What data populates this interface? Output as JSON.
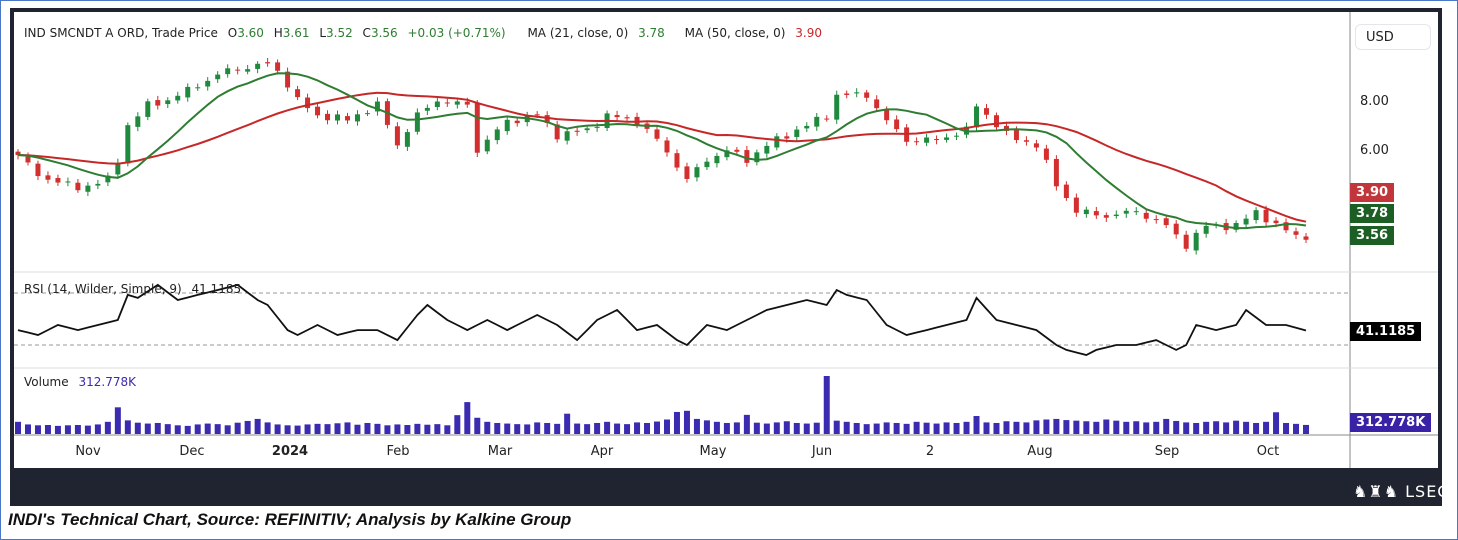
{
  "header": {
    "symbol": "IND SMCNDT A ORD, Trade Price",
    "open_label": "O",
    "open": "3.60",
    "high_label": "H",
    "high": "3.61",
    "low_label": "L",
    "low": "3.52",
    "close_label": "C",
    "close": "3.56",
    "change": "+0.03 (+0.71%)",
    "ma21_label": "MA (21, close, 0)",
    "ma21_value": "3.78",
    "ma50_label": "MA (50, close, 0)",
    "ma50_value": "3.90"
  },
  "axis": {
    "currency": "USD",
    "ticks": [
      "8.00",
      "6.00"
    ],
    "ma50_box": "3.90",
    "ma21_box": "3.78",
    "close_box": "3.56"
  },
  "rsi": {
    "label": "RSI (14, Wilder, Simple, 9)",
    "value": "41.1185",
    "box": "41.1185"
  },
  "volume": {
    "label": "Volume",
    "value": "312.778K",
    "box": "312.778K"
  },
  "xaxis": {
    "labels": [
      "Nov",
      "Dec",
      "2024",
      "Feb",
      "Mar",
      "Apr",
      "May",
      "Jun",
      "2",
      "Aug",
      "Sep",
      "Oct"
    ]
  },
  "branding": {
    "logo": "LSEG"
  },
  "caption": "INDI's Technical Chart, Source: REFINITIV; Analysis by Kalkine Group",
  "colors": {
    "up": "#1f8a3e",
    "down": "#d32f2f",
    "ma21": "#2e7d32",
    "ma50": "#c62828",
    "volume": "#3b2bb0",
    "rsi": "#111111"
  },
  "chart_data": {
    "type": "candlestick",
    "title": "IND SMCNDT A ORD, Trade Price",
    "price_scale": "log",
    "bars": 130,
    "close_keypoints": [
      [
        0,
        5.86
      ],
      [
        2,
        5.2
      ],
      [
        6,
        4.82
      ],
      [
        9,
        5.07
      ],
      [
        10,
        5.69
      ],
      [
        11,
        6.98
      ],
      [
        13,
        7.85
      ],
      [
        15,
        8.09
      ],
      [
        17,
        8.58
      ],
      [
        21,
        9.64
      ],
      [
        25,
        10.0
      ],
      [
        26,
        9.64
      ],
      [
        28,
        8.09
      ],
      [
        30,
        7.39
      ],
      [
        33,
        7.22
      ],
      [
        36,
        7.85
      ],
      [
        38,
        6.21
      ],
      [
        40,
        7.39
      ],
      [
        42,
        8.09
      ],
      [
        45,
        7.85
      ],
      [
        46,
        6.03
      ],
      [
        49,
        7.14
      ],
      [
        52,
        7.39
      ],
      [
        54,
        6.59
      ],
      [
        57,
        6.78
      ],
      [
        59,
        7.39
      ],
      [
        62,
        7.14
      ],
      [
        64,
        6.4
      ],
      [
        67,
        5.07
      ],
      [
        69,
        5.69
      ],
      [
        71,
        6.03
      ],
      [
        73,
        5.69
      ],
      [
        75,
        6.21
      ],
      [
        77,
        6.59
      ],
      [
        79,
        6.98
      ],
      [
        81,
        7.39
      ],
      [
        82,
        8.34
      ],
      [
        85,
        8.34
      ],
      [
        87,
        7.14
      ],
      [
        89,
        6.4
      ],
      [
        92,
        6.4
      ],
      [
        95,
        6.78
      ],
      [
        96,
        7.85
      ],
      [
        99,
        6.59
      ],
      [
        102,
        6.21
      ],
      [
        104,
        4.92
      ],
      [
        106,
        4.21
      ],
      [
        109,
        4.09
      ],
      [
        112,
        4.21
      ],
      [
        115,
        3.86
      ],
      [
        117,
        3.45
      ],
      [
        119,
        3.86
      ],
      [
        122,
        3.86
      ],
      [
        124,
        4.21
      ],
      [
        126,
        3.86
      ],
      [
        129,
        3.56
      ]
    ],
    "ma_periods_bars": [
      10,
      25
    ],
    "rsi_keypoints": [
      [
        0,
        41.5
      ],
      [
        2,
        37.7
      ],
      [
        4,
        45.4
      ],
      [
        6,
        41.5
      ],
      [
        8,
        45.4
      ],
      [
        10,
        49.2
      ],
      [
        11,
        68.5
      ],
      [
        12,
        66.2
      ],
      [
        14,
        76.2
      ],
      [
        16,
        64.6
      ],
      [
        18,
        68.5
      ],
      [
        20,
        72.3
      ],
      [
        22,
        76.2
      ],
      [
        24,
        64.6
      ],
      [
        25,
        60.8
      ],
      [
        27,
        41.5
      ],
      [
        28,
        37.7
      ],
      [
        30,
        45.4
      ],
      [
        32,
        37.7
      ],
      [
        34,
        41.5
      ],
      [
        36,
        41.5
      ],
      [
        38,
        33.8
      ],
      [
        40,
        53.1
      ],
      [
        41,
        60.8
      ],
      [
        43,
        49.2
      ],
      [
        45,
        41.5
      ],
      [
        47,
        49.2
      ],
      [
        49,
        41.5
      ],
      [
        52,
        53.1
      ],
      [
        54,
        45.4
      ],
      [
        56,
        33.8
      ],
      [
        58,
        49.2
      ],
      [
        60,
        56.9
      ],
      [
        62,
        41.5
      ],
      [
        64,
        45.4
      ],
      [
        66,
        33.8
      ],
      [
        67,
        30
      ],
      [
        69,
        45.4
      ],
      [
        71,
        41.5
      ],
      [
        73,
        49.2
      ],
      [
        75,
        56.9
      ],
      [
        77,
        60.8
      ],
      [
        79,
        64.6
      ],
      [
        81,
        60.8
      ],
      [
        82,
        72.3
      ],
      [
        83,
        68.5
      ],
      [
        85,
        64.6
      ],
      [
        87,
        45.4
      ],
      [
        89,
        37.7
      ],
      [
        91,
        41.5
      ],
      [
        93,
        45.4
      ],
      [
        95,
        49.2
      ],
      [
        96,
        66.2
      ],
      [
        98,
        49.2
      ],
      [
        100,
        45.4
      ],
      [
        102,
        41.5
      ],
      [
        104,
        30
      ],
      [
        105,
        26.2
      ],
      [
        107,
        22.3
      ],
      [
        108,
        26.2
      ],
      [
        110,
        30
      ],
      [
        112,
        30
      ],
      [
        114,
        33.8
      ],
      [
        116,
        26.2
      ],
      [
        117,
        30
      ],
      [
        118,
        45.4
      ],
      [
        120,
        41.5
      ],
      [
        122,
        45.4
      ],
      [
        123,
        56.9
      ],
      [
        125,
        45.4
      ],
      [
        127,
        45.4
      ],
      [
        129,
        41.1185
      ]
    ],
    "rsi_levels": [
      70,
      30
    ],
    "rsi_range": [
      10,
      90
    ],
    "volume_k": [
      420,
      330,
      300,
      310,
      280,
      300,
      310,
      290,
      330,
      420,
      920,
      470,
      390,
      360,
      380,
      340,
      300,
      280,
      330,
      360,
      340,
      300,
      390,
      450,
      520,
      400,
      330,
      300,
      290,
      330,
      350,
      340,
      370,
      400,
      320,
      380,
      350,
      300,
      330,
      310,
      350,
      320,
      340,
      300,
      650,
      1100,
      560,
      420,
      380,
      360,
      340,
      330,
      400,
      380,
      350,
      700,
      360,
      340,
      380,
      420,
      360,
      340,
      400,
      380,
      430,
      500,
      760,
      800,
      520,
      470,
      420,
      380,
      400,
      660,
      390,
      360,
      400,
      440,
      380,
      360,
      390,
      2000,
      460,
      420,
      380,
      340,
      360,
      400,
      380,
      350,
      420,
      390,
      360,
      400,
      380,
      420,
      620,
      400,
      380,
      440,
      420,
      400,
      470,
      500,
      520,
      480,
      460,
      440,
      420,
      500,
      460,
      420,
      440,
      400,
      420,
      520,
      450,
      400,
      380,
      420,
      440,
      400,
      460,
      420,
      380,
      420,
      750,
      380,
      350,
      312.778
    ],
    "x_range_labels": [
      "Nov",
      "Dec",
      "2024",
      "Feb",
      "Mar",
      "Apr",
      "May",
      "Jun",
      "2",
      "Aug",
      "Sep",
      "Oct"
    ],
    "ylim": [
      3.2,
      10.5
    ]
  }
}
